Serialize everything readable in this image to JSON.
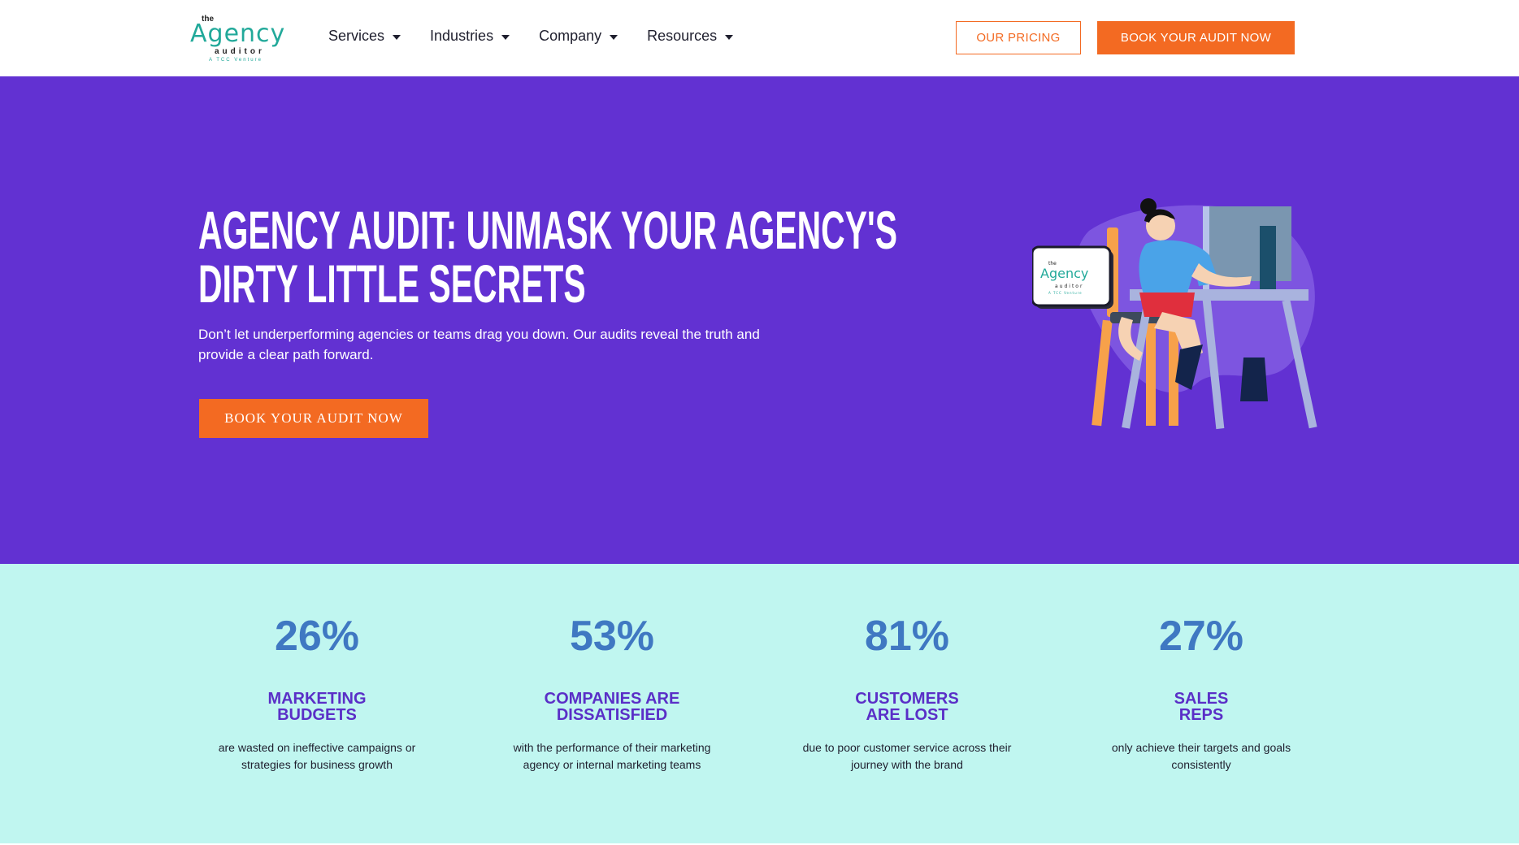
{
  "header": {
    "logo": {
      "the": "the",
      "agency": "Agency",
      "auditor": "auditor",
      "venture": "A TCC Venture"
    },
    "nav": [
      {
        "label": "Services"
      },
      {
        "label": "Industries"
      },
      {
        "label": "Company"
      },
      {
        "label": "Resources"
      }
    ],
    "pricing_label": "OUR PRICING",
    "book_label": "BOOK YOUR AUDIT NOW"
  },
  "hero": {
    "title_line1": "AGENCY AUDIT: UNMASK YOUR AGENCY'S",
    "title_line2": "DIRTY LITTLE SECRETS",
    "subtitle": "Don’t let underperforming agencies or teams drag you down. Our audits reveal the truth and provide a clear path forward.",
    "cta_label": "BOOK YOUR AUDIT NOW",
    "laptop_logo": {
      "the": "the",
      "agency": "Agency",
      "auditor": "auditor",
      "venture": "A TCC Venture"
    }
  },
  "stats": [
    {
      "value": "26%",
      "title": "MARKETING\nBUDGETS",
      "desc": "are wasted on ineffective campaigns or\nstrategies for business growth"
    },
    {
      "value": "53%",
      "title": "COMPANIES ARE\nDISSATISFIED",
      "desc": "with the performance of their marketing\nagency or internal marketing teams"
    },
    {
      "value": "81%",
      "title": "CUSTOMERS\nARE LOST",
      "desc": "due to poor customer service across their\njourney with the brand"
    },
    {
      "value": "27%",
      "title": "SALES\nREPS",
      "desc": "only achieve their targets and goals\nconsistently"
    }
  ],
  "colors": {
    "brand_purple": "#6231d2",
    "accent_orange": "#f36a22",
    "stats_bg": "#c0f6f0",
    "stat_value": "#3f78c2",
    "stat_title": "#5a2fc7"
  }
}
